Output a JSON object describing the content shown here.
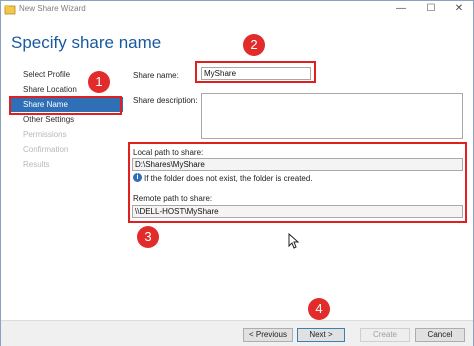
{
  "window": {
    "title": "New Share Wizard"
  },
  "page": {
    "title": "Specify share name"
  },
  "nav": {
    "items": [
      {
        "label": "Select Profile",
        "state": "normal"
      },
      {
        "label": "Share Location",
        "state": "normal"
      },
      {
        "label": "Share Name",
        "state": "selected"
      },
      {
        "label": "Other Settings",
        "state": "normal"
      },
      {
        "label": "Permissions",
        "state": "disabled"
      },
      {
        "label": "Confirmation",
        "state": "disabled"
      },
      {
        "label": "Results",
        "state": "disabled"
      }
    ]
  },
  "form": {
    "share_name_label": "Share name:",
    "share_name_value": "MyShare",
    "share_description_label": "Share description:",
    "share_description_value": "",
    "local_path_label": "Local path to share:",
    "local_path_value": "D:\\Shares\\MyShare",
    "info_text": "If the folder does not exist, the folder is created.",
    "remote_path_label": "Remote path to share:",
    "remote_path_value": "\\\\DELL-HOST\\MyShare"
  },
  "annotations": {
    "one": "1",
    "two": "2",
    "three": "3",
    "four": "4"
  },
  "buttons": {
    "previous": "< Previous",
    "next": "Next >",
    "create": "Create",
    "cancel": "Cancel"
  },
  "colors": {
    "accent": "#2f6fb6",
    "annotation": "#e02020",
    "title": "#1a5aa0"
  }
}
